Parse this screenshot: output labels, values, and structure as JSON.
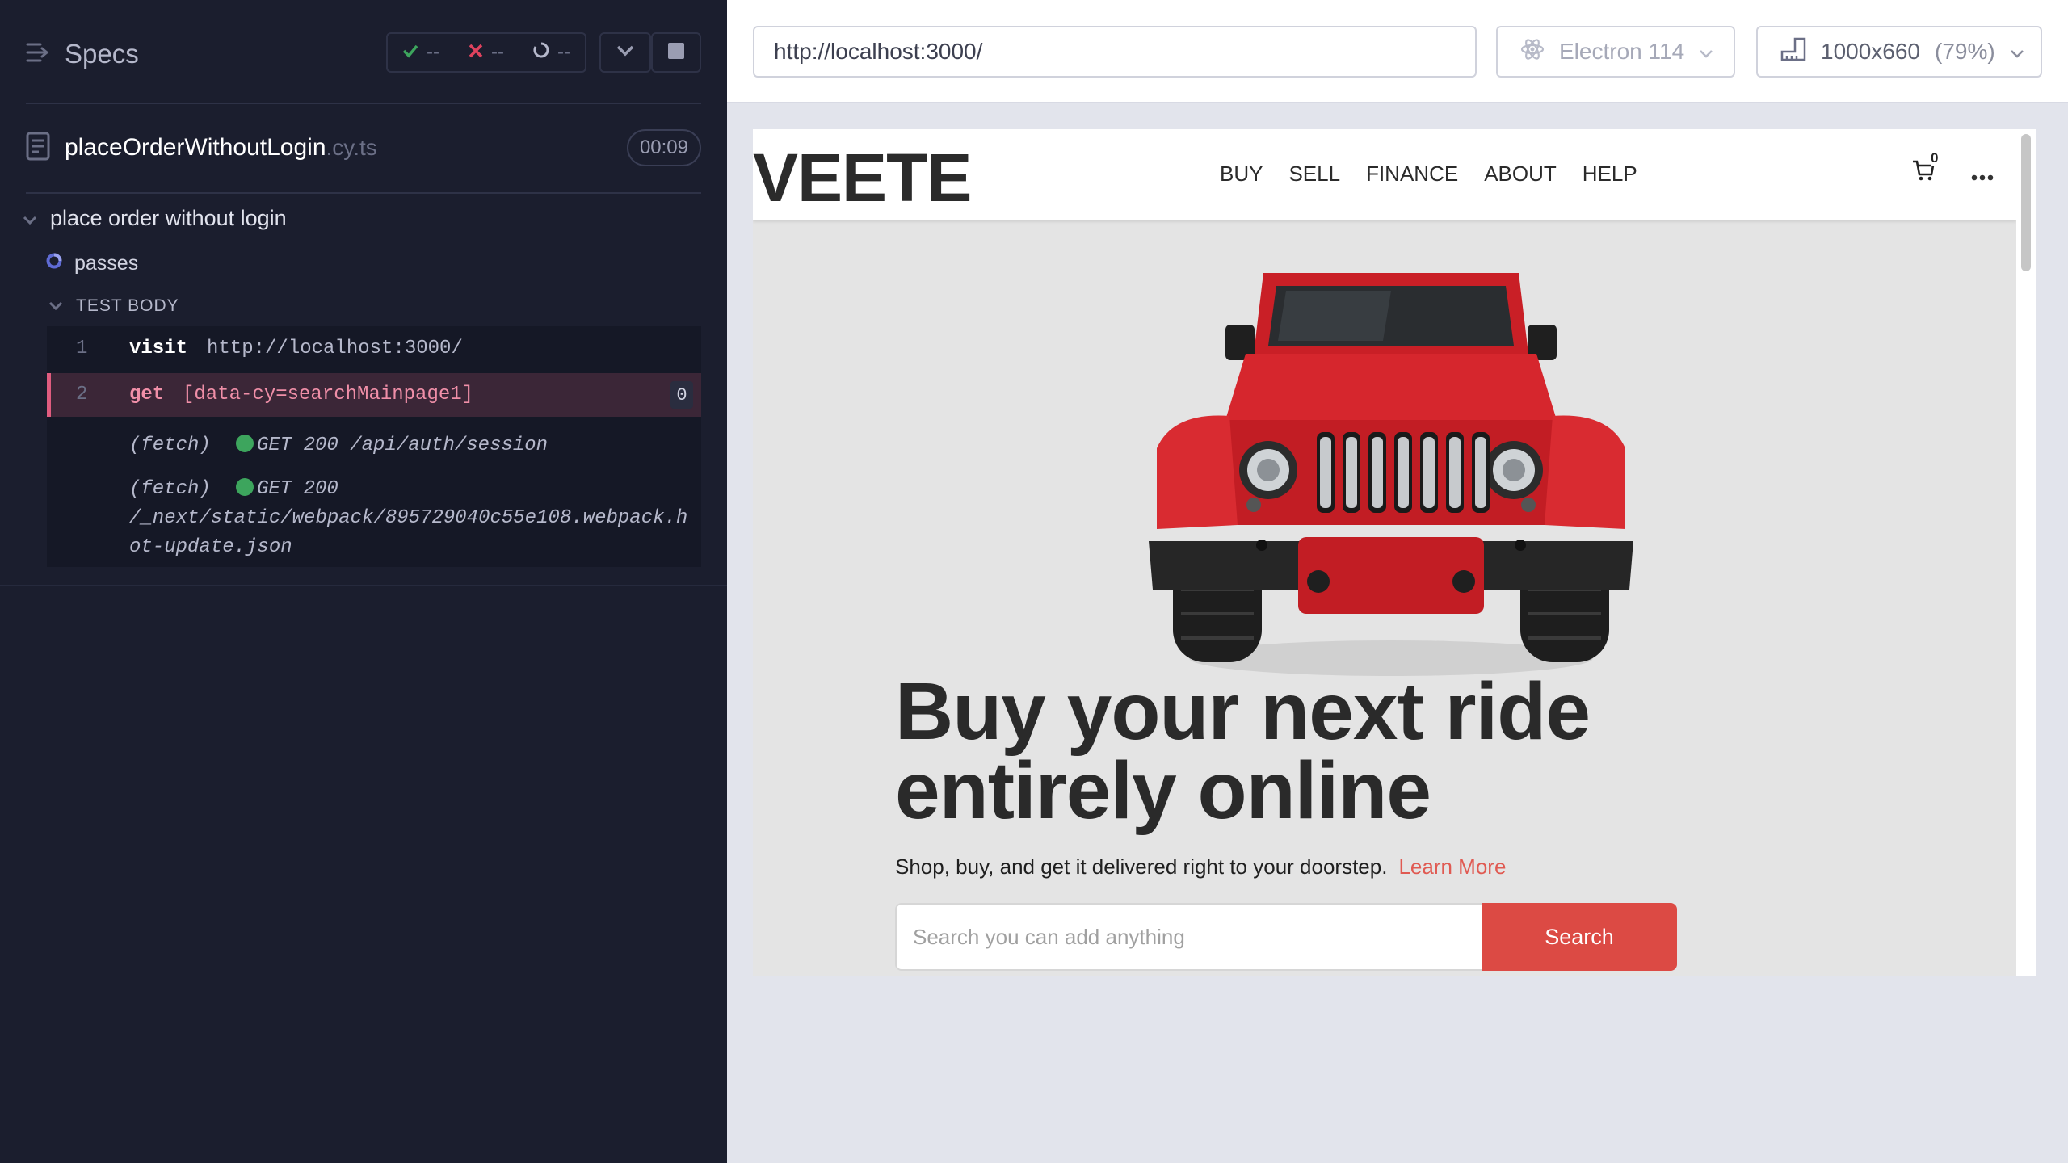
{
  "reporter": {
    "specs_label": "Specs",
    "stats": {
      "passed": "--",
      "failed": "--",
      "pending": "--"
    },
    "spec": {
      "name": "placeOrderWithoutLogin",
      "ext": ".cy.ts",
      "duration": "00:09"
    },
    "suite_title": "place order without login",
    "test_title": "passes",
    "hook_label": "TEST BODY",
    "commands": [
      {
        "num": "1",
        "name": "visit",
        "message": "http://localhost:3000/"
      },
      {
        "num": "2",
        "name": "get",
        "message": "[data-cy=searchMainpage1]",
        "badge": "0"
      }
    ],
    "requests": [
      {
        "prefix": "(fetch)",
        "method": "GET 200",
        "path": "/api/auth/session"
      },
      {
        "prefix": "(fetch)",
        "method": "GET 200",
        "path_line1": "/_next/static/webpack/895729040c55e108.webpack.h",
        "path_line2": "ot-update.json"
      }
    ]
  },
  "aut": {
    "url": "http://localhost:3000/",
    "browser": "Electron 114",
    "viewport": "1000x660",
    "scale": "(79%)"
  },
  "site": {
    "logo": "VEETE",
    "nav": [
      "BUY",
      "SELL",
      "FINANCE",
      "ABOUT",
      "HELP"
    ],
    "cart_count": "0",
    "hero_title_line1": "Buy your next ride",
    "hero_title_line2": "entirely online",
    "hero_sub": "Shop, buy, and get it delivered right to your doorstep.",
    "learn_more": "Learn More",
    "search_placeholder": "Search you can add anything",
    "search_button": "Search"
  },
  "colors": {
    "reporter_bg": "#1b1e2e",
    "active_cmd": "#f08fa8",
    "brand_red": "#dc4a44",
    "success_dot": "#3da55d"
  }
}
